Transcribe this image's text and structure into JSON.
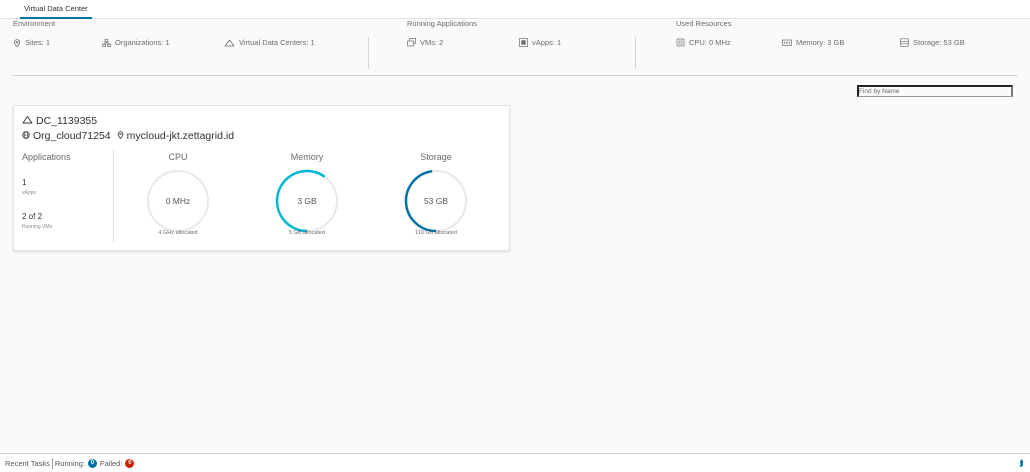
{
  "tabs": [
    {
      "label": "Virtual Data Center"
    }
  ],
  "summary": {
    "environment": {
      "title": "Environment",
      "sites": "Sites: 1",
      "organizations": "Organizations: 1",
      "vdcs": "Virtual Data Centers: 1"
    },
    "running": {
      "title": "Running Applications",
      "vms": "VMs: 2",
      "vapps": "vApps: 1"
    },
    "resources": {
      "title": "Used Resources",
      "cpu": "CPU: 0 MHz",
      "memory": "Memory: 3 GB",
      "storage": "Storage: 53 GB"
    }
  },
  "search": {
    "placeholder": "Find by Name"
  },
  "card": {
    "name": "DC_1139355",
    "org": "Org_cloud71254",
    "site": "mycloud-jkt.zettagrid.id",
    "applications": {
      "title": "Applications",
      "vapps_count": "1",
      "vapps_label": "vApps",
      "vms_count": "2 of 2",
      "vms_label": "Running VMs"
    },
    "gauges": [
      {
        "title": "CPU",
        "value": "0 MHz",
        "allocated": "4 GHz allocated",
        "fraction": 0.0,
        "color": "#0072a3"
      },
      {
        "title": "Memory",
        "value": "3 GB",
        "allocated": "5 GB allocated",
        "fraction": 0.6,
        "color": "#00b7d6"
      },
      {
        "title": "Storage",
        "value": "53 GB",
        "allocated": "110 GB allocated",
        "fraction": 0.48,
        "color": "#0072a3"
      }
    ]
  },
  "footer": {
    "recent_tasks": "Recent Tasks",
    "running_label": "Running:",
    "running_count": "0",
    "failed_label": "Failed:",
    "failed_count": "0"
  }
}
